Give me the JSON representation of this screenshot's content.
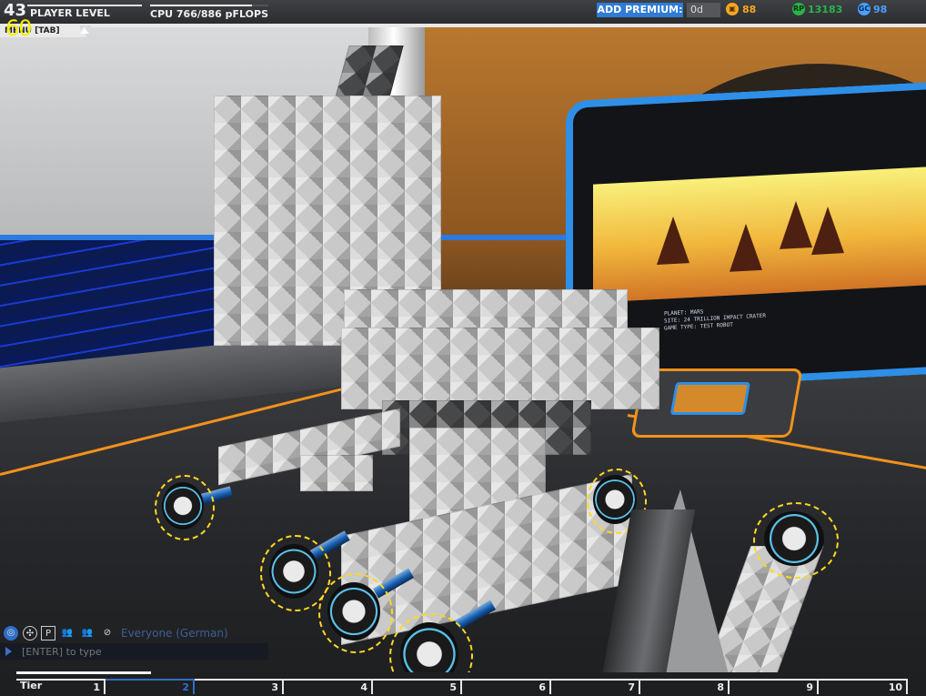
{
  "hud": {
    "player_level": "43",
    "player_level_label": "PLAYER LEVEL",
    "cpu_label": "CPU 766/886 pFLOPS",
    "cpu_used": 766,
    "cpu_max": 886,
    "fps": "60",
    "menu_label": "MENU [TAB]",
    "premium_label": "ADD PREMIUM:",
    "premium_days": "0d",
    "currencies": [
      {
        "icon": "crate-icon",
        "value": "88",
        "color": "#f5a623"
      },
      {
        "icon": "robit-points-icon",
        "value": "13183",
        "color": "#2bb24c"
      },
      {
        "icon": "galaxy-coins-icon",
        "value": "98",
        "color": "#4aa0ff"
      }
    ]
  },
  "monitor": {
    "planet": "PLANET: MARS",
    "site": "SITE: 24 TRILLION IMPACT CRATER",
    "game_type": "GAME TYPE: TEST ROBOT"
  },
  "chat": {
    "channel": "Everyone (German)",
    "placeholder": "[ENTER] to type",
    "icons": [
      "globe-icon",
      "clan-icon",
      "party-icon",
      "friends-icon",
      "group-icon",
      "block-icon"
    ]
  },
  "tiers": {
    "label": "Tier",
    "items": [
      "1",
      "2",
      "3",
      "4",
      "5",
      "6",
      "7",
      "8",
      "9",
      "10"
    ],
    "current_index": 1,
    "colors": {
      "accent": "#2e6fc7",
      "line": "#e6e6e6"
    }
  }
}
